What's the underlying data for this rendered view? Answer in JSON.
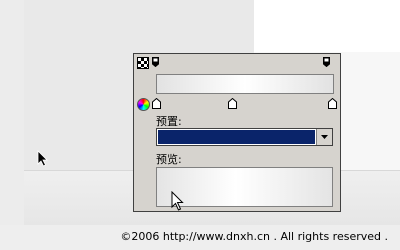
{
  "footer": {
    "copyright": "©2006 http://www.dnxh.cn . All rights reserved ."
  },
  "gradient_panel": {
    "preset_label": "预置:",
    "preview_label": "预览:",
    "preset_selected_color": "#0a246a",
    "icons": [
      "gradient-pattern-icon",
      "color-wheel-icon",
      "dropdown-arrow-icon",
      "mouse-pointer-icon"
    ]
  },
  "colors": {
    "panel_background": "#d6d3ce",
    "selection_blue": "#0a246a"
  }
}
